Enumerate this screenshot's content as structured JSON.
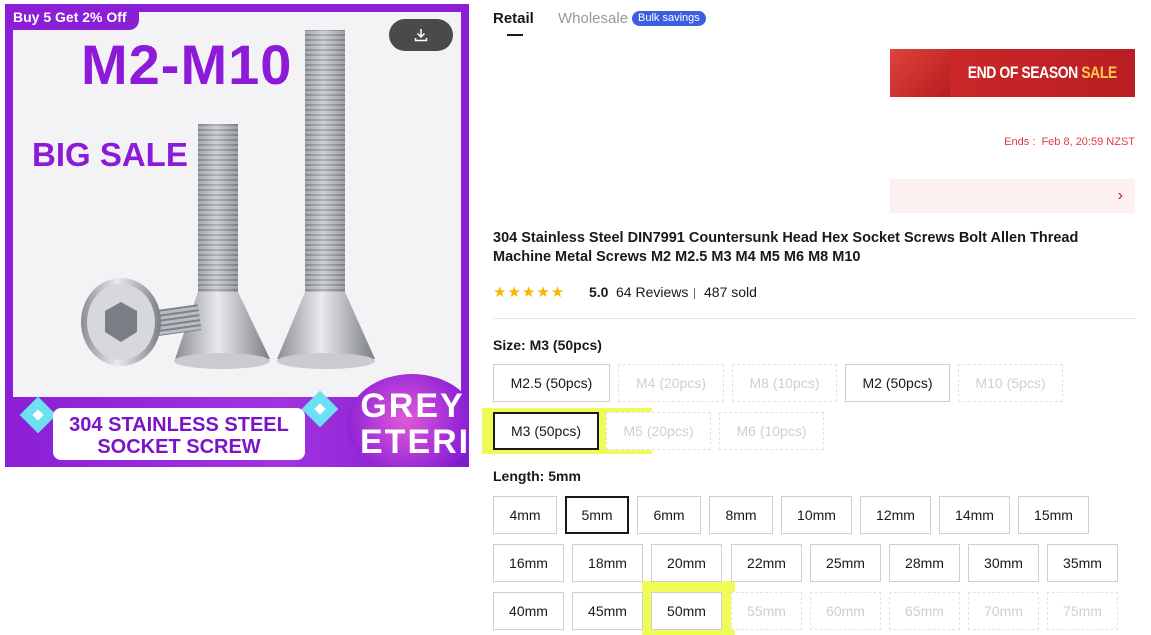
{
  "product_image": {
    "promo_tag": "Buy 5 Get 2% Off",
    "size_headline": "M2-M10",
    "big_sale": "BIG SALE",
    "material_line1": "304 STAINLESS STEEL",
    "material_line2": "SOCKET SCREW",
    "brand_line1": "GREY",
    "brand_line2": "ETERI",
    "download_icon": "download-icon"
  },
  "tabs": [
    {
      "label": "Retail",
      "active": true
    },
    {
      "label": "Wholesale",
      "active": false
    }
  ],
  "bulk_badge": "Bulk savings",
  "season_banner": {
    "text_main": "END OF SEASON",
    "text_accent": "SALE"
  },
  "ends": {
    "label": "Ends :",
    "value": "Feb 8, 20:59 NZST"
  },
  "promo_strip": {
    "chevron_icon": "chevron-right-icon"
  },
  "product": {
    "title": "304 Stainless Steel DIN7991 Countersunk Head Hex Socket Screws Bolt Allen Thread Machine Metal Screws M2 M2.5 M3 M4 M5 M6 M8 M10",
    "stars": "★★★★★",
    "rating": "5.0",
    "reviews": "64 Reviews",
    "sold": "487 sold"
  },
  "size": {
    "label": "Size: M3 (50pcs)",
    "options": [
      {
        "label": "M2.5 (50pcs)",
        "state": "available"
      },
      {
        "label": "M4 (20pcs)",
        "state": "disabled"
      },
      {
        "label": "M8 (10pcs)",
        "state": "disabled"
      },
      {
        "label": "M2 (50pcs)",
        "state": "available"
      },
      {
        "label": "M10 (5pcs)",
        "state": "disabled"
      },
      {
        "label": "M3 (50pcs)",
        "state": "selected"
      },
      {
        "label": "M5 (20pcs)",
        "state": "disabled"
      },
      {
        "label": "M6 (10pcs)",
        "state": "disabled"
      }
    ]
  },
  "length": {
    "label": "Length: 5mm",
    "options": [
      {
        "label": "4mm",
        "state": "available"
      },
      {
        "label": "5mm",
        "state": "selected"
      },
      {
        "label": "6mm",
        "state": "available"
      },
      {
        "label": "8mm",
        "state": "available"
      },
      {
        "label": "10mm",
        "state": "available"
      },
      {
        "label": "12mm",
        "state": "available"
      },
      {
        "label": "14mm",
        "state": "available"
      },
      {
        "label": "15mm",
        "state": "available"
      },
      {
        "label": "16mm",
        "state": "available"
      },
      {
        "label": "18mm",
        "state": "available"
      },
      {
        "label": "20mm",
        "state": "available"
      },
      {
        "label": "22mm",
        "state": "available"
      },
      {
        "label": "25mm",
        "state": "available"
      },
      {
        "label": "28mm",
        "state": "available"
      },
      {
        "label": "30mm",
        "state": "available"
      },
      {
        "label": "35mm",
        "state": "available"
      },
      {
        "label": "40mm",
        "state": "available"
      },
      {
        "label": "45mm",
        "state": "available"
      },
      {
        "label": "50mm",
        "state": "available"
      },
      {
        "label": "55mm",
        "state": "disabled"
      },
      {
        "label": "60mm",
        "state": "disabled"
      },
      {
        "label": "65mm",
        "state": "disabled"
      },
      {
        "label": "70mm",
        "state": "disabled"
      },
      {
        "label": "75mm",
        "state": "disabled"
      }
    ]
  },
  "colors": {
    "accent_purple": "#8a1fd6",
    "sale_red": "#c01818",
    "star_yellow": "#f7b500",
    "badge_blue": "#3b5fe0",
    "highlight_yellow": "#ebfa28"
  }
}
